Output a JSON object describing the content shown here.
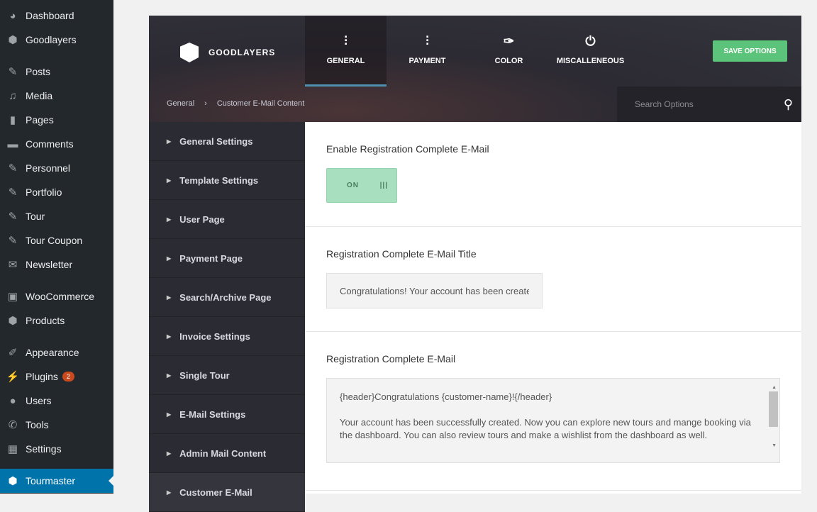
{
  "wp_menu": [
    {
      "label": "Dashboard",
      "icon": "dashboard-icon",
      "glyph": "◕"
    },
    {
      "label": "Goodlayers",
      "icon": "goodlayers-icon",
      "glyph": "⬢"
    },
    {
      "label": "Posts",
      "icon": "pin-icon",
      "glyph": "✎"
    },
    {
      "label": "Media",
      "icon": "media-icon",
      "glyph": "♫"
    },
    {
      "label": "Pages",
      "icon": "pages-icon",
      "glyph": "▮"
    },
    {
      "label": "Comments",
      "icon": "comment-icon",
      "glyph": "▬"
    },
    {
      "label": "Personnel",
      "icon": "pin-icon",
      "glyph": "✎"
    },
    {
      "label": "Portfolio",
      "icon": "pin-icon",
      "glyph": "✎"
    },
    {
      "label": "Tour",
      "icon": "pin-icon",
      "glyph": "✎"
    },
    {
      "label": "Tour Coupon",
      "icon": "pin-icon",
      "glyph": "✎"
    },
    {
      "label": "Newsletter",
      "icon": "mail-icon",
      "glyph": "✉"
    },
    {
      "label": "WooCommerce",
      "icon": "woo-icon",
      "glyph": "▣"
    },
    {
      "label": "Products",
      "icon": "box-icon",
      "glyph": "⬢"
    },
    {
      "label": "Appearance",
      "icon": "brush-icon",
      "glyph": "✐"
    },
    {
      "label": "Plugins",
      "icon": "plugin-icon",
      "glyph": "⚡",
      "badge": "2"
    },
    {
      "label": "Users",
      "icon": "user-icon",
      "glyph": "●"
    },
    {
      "label": "Tools",
      "icon": "wrench-icon",
      "glyph": "✆"
    },
    {
      "label": "Settings",
      "icon": "settings-icon",
      "glyph": "▦"
    },
    {
      "label": "Tourmaster",
      "icon": "tourmaster-icon",
      "glyph": "⬢"
    }
  ],
  "header": {
    "logo": "GOODLAYERS",
    "tabs": [
      {
        "label": "GENERAL",
        "glyph": "⫶"
      },
      {
        "label": "PAYMENT",
        "glyph": "⫶"
      },
      {
        "label": "COLOR",
        "glyph": "✑"
      },
      {
        "label": "MISCALLENEOUS",
        "glyph": "⏻"
      }
    ],
    "save": "SAVE OPTIONS"
  },
  "breadcrumb": {
    "root": "General",
    "sep": "›",
    "current": "Customer E-Mail Content"
  },
  "search": {
    "placeholder": "Search Options"
  },
  "nav": [
    "General Settings",
    "Template Settings",
    "User Page",
    "Payment Page",
    "Search/Archive Page",
    "Invoice Settings",
    "Single Tour",
    "E-Mail Settings",
    "Admin Mail Content",
    "Customer E-Mail"
  ],
  "fields": {
    "enable_label": "Enable Registration Complete E-Mail",
    "enable_value": "ON",
    "title_label": "Registration Complete E-Mail Title",
    "title_value": "Congratulations! Your account has been created",
    "email_label": "Registration Complete E-Mail",
    "email_line1": "{header}Congratulations {customer-name}!{/header}",
    "email_line2": "Your account has been successfully created. Now you can explore new tours and mange booking via the dashboard. You can also review tours and make a wishlist from the dashboard as well."
  }
}
